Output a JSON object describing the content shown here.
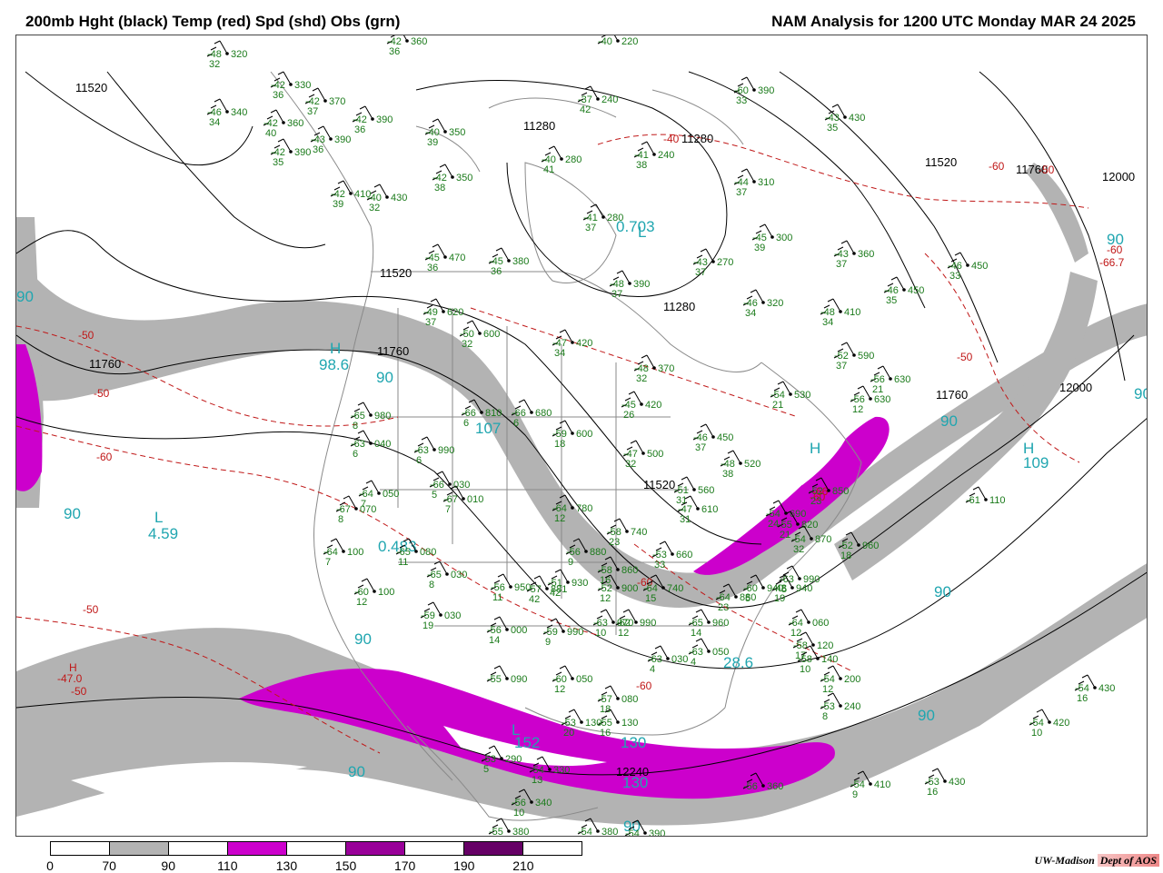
{
  "header": {
    "left_title": "200mb Hght (black) Temp (red) Spd (shd) Obs (grn)",
    "right_title": "NAM Analysis for 1200 UTC Monday  MAR 24 2025"
  },
  "colors": {
    "height_contour": "#000000",
    "temp_contour": "#c01818",
    "obs_text": "#1a7a1a",
    "speed_label": "#20a6b0",
    "borders": "#8a8a8a",
    "shade_70_90": "#b3b3b3",
    "shade_110_130": "#cc00cc",
    "shade_150_170": "#990099",
    "shade_190_210": "#660066"
  },
  "colorbar": {
    "ticks": [
      "0",
      "70",
      "90",
      "110",
      "130",
      "150",
      "170",
      "190",
      "210"
    ],
    "segments": [
      "#ffffff",
      "#b3b3b3",
      "#ffffff",
      "#cc00cc",
      "#ffffff",
      "#990099",
      "#ffffff",
      "#660066",
      "#ffffff"
    ]
  },
  "credit": {
    "org": "UW-Madison",
    "dept": "Dept of AOS"
  },
  "height_labels": [
    "11520",
    "11760",
    "11280",
    "11280",
    "11520",
    "11760",
    "12000",
    "11520",
    "11760",
    "12000",
    "11280",
    "11520",
    "11760",
    "12240"
  ],
  "temp_labels": [
    "-50",
    "-50",
    "-60",
    "-60",
    "-50",
    "-40",
    "-50",
    "-60",
    "-66.7",
    "-50",
    "-60",
    "-47.0",
    "-50",
    "-60",
    "-60",
    "-66"
  ],
  "speed_labels": [
    "90",
    "98.6",
    "90",
    "107",
    "90",
    "4.59",
    "0.483",
    "90",
    "152",
    "90",
    "130",
    "130",
    "90",
    "28.6",
    "90",
    "90",
    "90",
    "109",
    "90",
    "0.703",
    "90"
  ],
  "pressure_centers": [
    "H",
    "L",
    "H",
    "L",
    "H",
    "H",
    "L"
  ],
  "observations": [
    {
      "t": "-48",
      "d": "32",
      "h": "320"
    },
    {
      "t": "-42",
      "d": "36",
      "h": "360"
    },
    {
      "t": "-42",
      "d": "36",
      "h": "330"
    },
    {
      "t": "-42",
      "d": "37",
      "h": "370"
    },
    {
      "t": "-46",
      "d": "34",
      "h": "340"
    },
    {
      "t": "-42",
      "d": "36",
      "h": "390"
    },
    {
      "t": "-42",
      "d": "40",
      "h": "360"
    },
    {
      "t": "-43",
      "d": "36",
      "h": "390"
    },
    {
      "t": "-42",
      "d": "35",
      "h": "390"
    },
    {
      "t": "-40",
      "d": "39",
      "h": "350"
    },
    {
      "t": "-42",
      "d": "38",
      "h": "350"
    },
    {
      "t": "-42",
      "d": "39",
      "h": "410"
    },
    {
      "t": "-40",
      "d": "32",
      "h": "430"
    },
    {
      "t": "-45",
      "d": "36",
      "h": "470"
    },
    {
      "t": "-45",
      "d": "36",
      "h": "380"
    },
    {
      "t": "-37",
      "d": "42",
      "h": "240"
    },
    {
      "t": "-40",
      "d": "41",
      "h": "280"
    },
    {
      "t": "-41",
      "d": "38",
      "h": "240"
    },
    {
      "t": "-41",
      "d": "37",
      "h": "280"
    },
    {
      "t": "-60",
      "d": "33",
      "h": "390"
    },
    {
      "t": "-43",
      "d": "35",
      "h": "430"
    },
    {
      "t": "-44",
      "d": "37",
      "h": "310"
    },
    {
      "t": "-45",
      "d": "39",
      "h": "300"
    },
    {
      "t": "-43",
      "d": "37",
      "h": "270"
    },
    {
      "t": "-43",
      "d": "37",
      "h": "360"
    },
    {
      "t": "-46",
      "d": "33",
      "h": "450"
    },
    {
      "t": "-46",
      "d": "35",
      "h": "450"
    },
    {
      "t": "-48",
      "d": "37",
      "h": "390"
    },
    {
      "t": "-46",
      "d": "34",
      "h": "320"
    },
    {
      "t": "-48",
      "d": "34",
      "h": "410"
    },
    {
      "t": "-49",
      "d": "37",
      "h": "620"
    },
    {
      "t": "-50",
      "d": "32",
      "h": "600"
    },
    {
      "t": "-47",
      "d": "34",
      "h": "420"
    },
    {
      "t": "-48",
      "d": "32",
      "h": "370"
    },
    {
      "t": "-52",
      "d": "37",
      "h": "590"
    },
    {
      "t": "-56",
      "d": "21",
      "h": "630"
    },
    {
      "t": "-54",
      "d": "21",
      "h": "530"
    },
    {
      "t": "-56",
      "d": "12",
      "h": "630"
    },
    {
      "t": "-45",
      "d": "26",
      "h": "420"
    },
    {
      "t": "-65",
      "d": "8",
      "h": "980"
    },
    {
      "t": "-66",
      "d": "6",
      "h": "810"
    },
    {
      "t": "-66",
      "d": "6",
      "h": "680"
    },
    {
      "t": "-59",
      "d": "18",
      "h": "600"
    },
    {
      "t": "-47",
      "d": "32",
      "h": "500"
    },
    {
      "t": "-46",
      "d": "37",
      "h": "450"
    },
    {
      "t": "-48",
      "d": "38",
      "h": "520"
    },
    {
      "t": "-63",
      "d": "6",
      "h": "040"
    },
    {
      "t": "-63",
      "d": "6",
      "h": "990"
    },
    {
      "t": "-64",
      "d": "7",
      "h": "050"
    },
    {
      "t": "-66",
      "d": "5",
      "h": "030"
    },
    {
      "t": "-67",
      "d": "7",
      "h": "010"
    },
    {
      "t": "-64",
      "d": "12",
      "h": "780"
    },
    {
      "t": "-51",
      "d": "31",
      "h": "560"
    },
    {
      "t": "-47",
      "d": "31",
      "h": "610"
    },
    {
      "t": "-54",
      "d": "24",
      "h": "690"
    },
    {
      "t": "-67",
      "d": "8",
      "h": "070"
    },
    {
      "t": "-64",
      "d": "7",
      "h": "100"
    },
    {
      "t": "-65",
      "d": "11",
      "h": "080"
    },
    {
      "t": "-65",
      "d": "8",
      "h": "030"
    },
    {
      "t": "-58",
      "d": "23",
      "h": "740"
    },
    {
      "t": "-56",
      "d": "9",
      "h": "880"
    },
    {
      "t": "-58",
      "d": "16",
      "h": "860"
    },
    {
      "t": "-53",
      "d": "33",
      "h": "660"
    },
    {
      "t": "-64",
      "d": "15",
      "h": "740"
    },
    {
      "t": "-60",
      "d": "12",
      "h": "100"
    },
    {
      "t": "-56",
      "d": "11",
      "h": "950"
    },
    {
      "t": "-57",
      "d": "42",
      "h": "881"
    },
    {
      "t": "-51",
      "d": "42",
      "h": "930"
    },
    {
      "t": "-52",
      "d": "12",
      "h": "900"
    },
    {
      "t": "-64",
      "d": "23",
      "h": "880"
    },
    {
      "t": "-60",
      "d": "5",
      "h": "940"
    },
    {
      "t": "-63",
      "d": "5",
      "h": "990"
    },
    {
      "t": "-52",
      "d": "23",
      "h": "850"
    },
    {
      "t": "-55",
      "d": "21",
      "h": "820"
    },
    {
      "t": "-54",
      "d": "32",
      "h": "870"
    },
    {
      "t": "-52",
      "d": "18",
      "h": "960"
    },
    {
      "t": "-48",
      "d": "19",
      "h": "940"
    },
    {
      "t": "-59",
      "d": "19",
      "h": "030"
    },
    {
      "t": "-56",
      "d": "14",
      "h": "000"
    },
    {
      "t": "-59",
      "d": "9",
      "h": "990"
    },
    {
      "t": "-63",
      "d": "10",
      "h": "970"
    },
    {
      "t": "-62",
      "d": "12",
      "h": "990"
    },
    {
      "t": "-65",
      "d": "14",
      "h": "960"
    },
    {
      "t": "-64",
      "d": "12",
      "h": "060"
    },
    {
      "t": "-63",
      "d": "4",
      "h": "030"
    },
    {
      "t": "-63",
      "d": "4",
      "h": "050"
    },
    {
      "t": "-58",
      "d": "17",
      "h": "120"
    },
    {
      "t": "-58",
      "d": "10",
      "h": "140"
    },
    {
      "t": "-54",
      "d": "12",
      "h": "200"
    },
    {
      "t": "-53",
      "d": "8",
      "h": "240"
    },
    {
      "t": "-61",
      "d": "",
      "h": "110"
    },
    {
      "t": "-54",
      "d": "16",
      "h": "430"
    },
    {
      "t": "-54",
      "d": "10",
      "h": "420"
    },
    {
      "t": "-55",
      "d": "",
      "h": "090"
    },
    {
      "t": "-60",
      "d": "12",
      "h": "050"
    },
    {
      "t": "-57",
      "d": "18",
      "h": "080"
    },
    {
      "t": "-55",
      "d": "16",
      "h": "130"
    },
    {
      "t": "-53",
      "d": "20",
      "h": "130"
    },
    {
      "t": "-56",
      "d": "",
      "h": "360"
    },
    {
      "t": "-53",
      "d": "5",
      "h": "290"
    },
    {
      "t": "-54",
      "d": "13",
      "h": "330"
    },
    {
      "t": "-56",
      "d": "10",
      "h": "340"
    },
    {
      "t": "-55",
      "d": "",
      "h": "380"
    },
    {
      "t": "-54",
      "d": "",
      "h": "380"
    },
    {
      "t": "-54",
      "d": "",
      "h": "390"
    },
    {
      "t": "-54",
      "d": "9",
      "h": "410"
    },
    {
      "t": "-53",
      "d": "16",
      "h": "430"
    },
    {
      "t": "-40",
      "d": "",
      "h": "220"
    }
  ]
}
